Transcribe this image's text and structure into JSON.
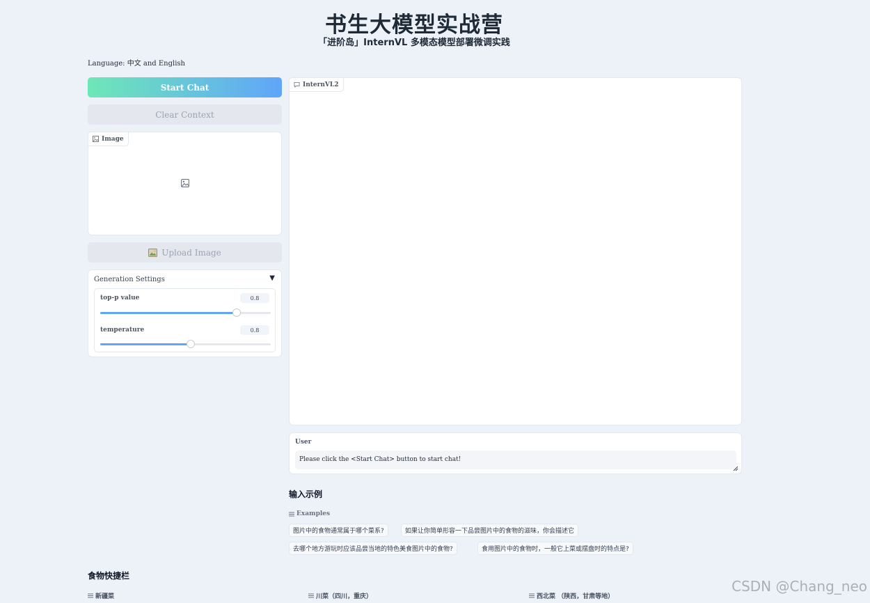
{
  "header": {
    "title": "书生大模型实战营",
    "subtitle": "「进阶岛」InternVL 多模态模型部署微调实践"
  },
  "language_note": "Language: 中文 and English",
  "left": {
    "start_chat_label": "Start Chat",
    "clear_context_label": "Clear Context",
    "image_panel_label": "Image",
    "upload_image_label": "Upload Image",
    "generation_settings": {
      "title": "Generation Settings",
      "top_p": {
        "label": "top-p value",
        "value": "0.8",
        "fraction": 0.8
      },
      "temperature": {
        "label": "temperature",
        "value": "0.8",
        "fraction": 0.53
      }
    }
  },
  "chatbot": {
    "label": "InternVL2"
  },
  "user_box": {
    "label": "User",
    "placeholder": "Please click the <Start Chat> button to start chat!"
  },
  "examples": {
    "heading": "输入示例",
    "label": "Examples",
    "items": [
      "图片中的食物通常属于哪个菜系?",
      "如果让你简单形容一下品尝图片中的食物的滋味，你会描述它",
      "去哪个地方游玩时应该品尝当地的特色美食图片中的食物?",
      "食用图片中的食物时，一般它上菜或摆盘时的特点是?"
    ]
  },
  "food_bar": {
    "heading": "食物快捷栏",
    "columns": [
      "新疆菜",
      "川菜（四川，重庆）",
      "西北菜 （陕西，甘肃等地）"
    ]
  },
  "watermark": "CSDN @Chang_neo",
  "colors": {
    "accent_start": "#6ee7b7",
    "accent_end": "#60a5fa",
    "background": "#edf1f8"
  }
}
